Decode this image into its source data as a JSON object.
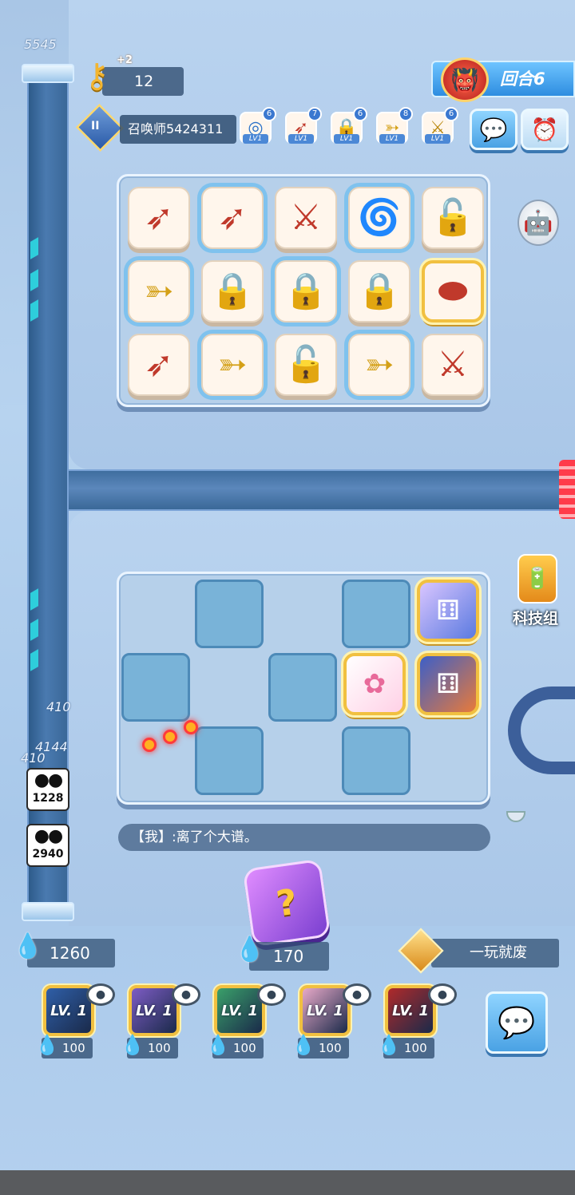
{
  "top": {
    "keys": "12",
    "key_bonus": "+2",
    "round": "回合6",
    "player_name": "召唤师5424311",
    "rank_numeral": "II",
    "score_top": "5545"
  },
  "skills": [
    {
      "icon": "ring-icon",
      "glyph": "◎",
      "level": "LV1",
      "count": "6",
      "color": "#2b72c8"
    },
    {
      "icon": "bow-icon",
      "glyph": "➶",
      "level": "LV1",
      "count": "7",
      "color": "#c0392b"
    },
    {
      "icon": "lock-icon",
      "glyph": "🔒",
      "level": "LV1",
      "count": "6",
      "color": "#8e44ad"
    },
    {
      "icon": "arrow-icon",
      "glyph": "➳",
      "level": "LV1",
      "count": "8",
      "color": "#d4a017"
    },
    {
      "icon": "crossbow-icon",
      "glyph": "⚔",
      "level": "LV1",
      "count": "6",
      "color": "#b8860b"
    }
  ],
  "opponent_board": [
    {
      "glyph": "➶",
      "color": "#c0392b",
      "style": ""
    },
    {
      "glyph": "➶",
      "color": "#c0392b",
      "style": "sel"
    },
    {
      "glyph": "⚔",
      "color": "#c0392b",
      "style": ""
    },
    {
      "glyph": "🌀",
      "color": "#1e88c8",
      "style": "sel"
    },
    {
      "glyph": "🔓",
      "color": "#9b59b6",
      "style": ""
    },
    {
      "glyph": "➳",
      "color": "#d4a017",
      "style": "sel"
    },
    {
      "glyph": "🔒",
      "color": "#9b59b6",
      "style": ""
    },
    {
      "glyph": "🔒",
      "color": "#9b59b6",
      "style": "sel"
    },
    {
      "glyph": "🔒",
      "color": "#9b59b6",
      "style": ""
    },
    {
      "glyph": "⬬",
      "color": "#c0392b",
      "style": "gold"
    },
    {
      "glyph": "➶",
      "color": "#c0392b",
      "style": ""
    },
    {
      "glyph": "➳",
      "color": "#d4a017",
      "style": "sel"
    },
    {
      "glyph": "🔓",
      "color": "#9b59b6",
      "style": ""
    },
    {
      "glyph": "➳",
      "color": "#d4a017",
      "style": "sel"
    },
    {
      "glyph": "⚔",
      "color": "#c0392b",
      "style": ""
    }
  ],
  "track": {
    "score_a": "410",
    "score_b": "4144",
    "score_c": "410",
    "foot_1": "1228",
    "foot_2": "2940"
  },
  "tech_group_label": "科技组",
  "chat_message": "【我】:离了个大谱。",
  "energy": "1260",
  "dice_cost": "170",
  "opponent_name": "一玩就废",
  "cards": [
    {
      "label": "LV. 1",
      "cost": "100",
      "bg": "#2f5fa8"
    },
    {
      "label": "LV. 1",
      "cost": "100",
      "bg": "#7d5cc4"
    },
    {
      "label": "LV. 1",
      "cost": "100",
      "bg": "#3aa06a"
    },
    {
      "label": "LV. 1",
      "cost": "100",
      "bg": "#e8a9c8"
    },
    {
      "label": "LV. 1",
      "cost": "100",
      "bg": "#b02a2a"
    }
  ]
}
